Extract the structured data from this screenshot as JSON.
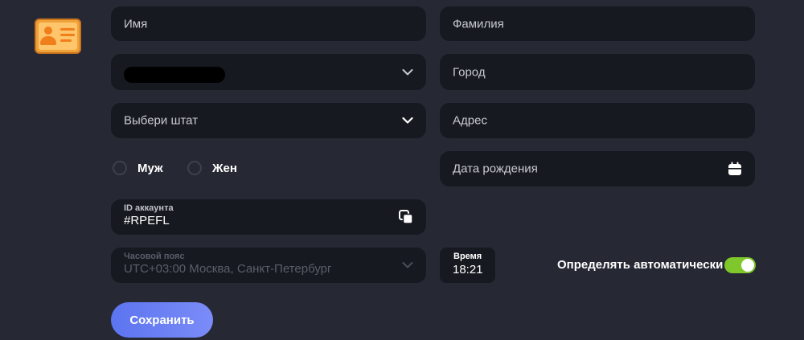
{
  "form": {
    "first_name_placeholder": "Имя",
    "last_name_placeholder": "Фамилия",
    "city_placeholder": "Город",
    "state_placeholder": "Выбери штат",
    "address_placeholder": "Адрес",
    "birthdate_placeholder": "Дата рождения",
    "gender": {
      "male_label": "Муж",
      "female_label": "Жен"
    },
    "account_id": {
      "label": "ID аккаунта",
      "value": "#RPEFL"
    },
    "timezone": {
      "label": "Часовой пояс",
      "value": "UTC+03:00 Москва, Санкт-Петербург"
    },
    "time": {
      "label": "Время",
      "value": "18:21"
    },
    "auto_detect_label": "Определять автоматически",
    "auto_detect_on": true,
    "save_label": "Сохранить"
  },
  "icons": {
    "profile": "id-card-icon",
    "dropdown": "chevron-down-icon",
    "calendar": "calendar-icon",
    "copy": "copy-icon"
  },
  "colors": {
    "background": "#262833",
    "field": "#171920",
    "accent": "#6c7ff5",
    "toggle_on": "#7fc72a",
    "icon_orange": "#f0a23a"
  }
}
